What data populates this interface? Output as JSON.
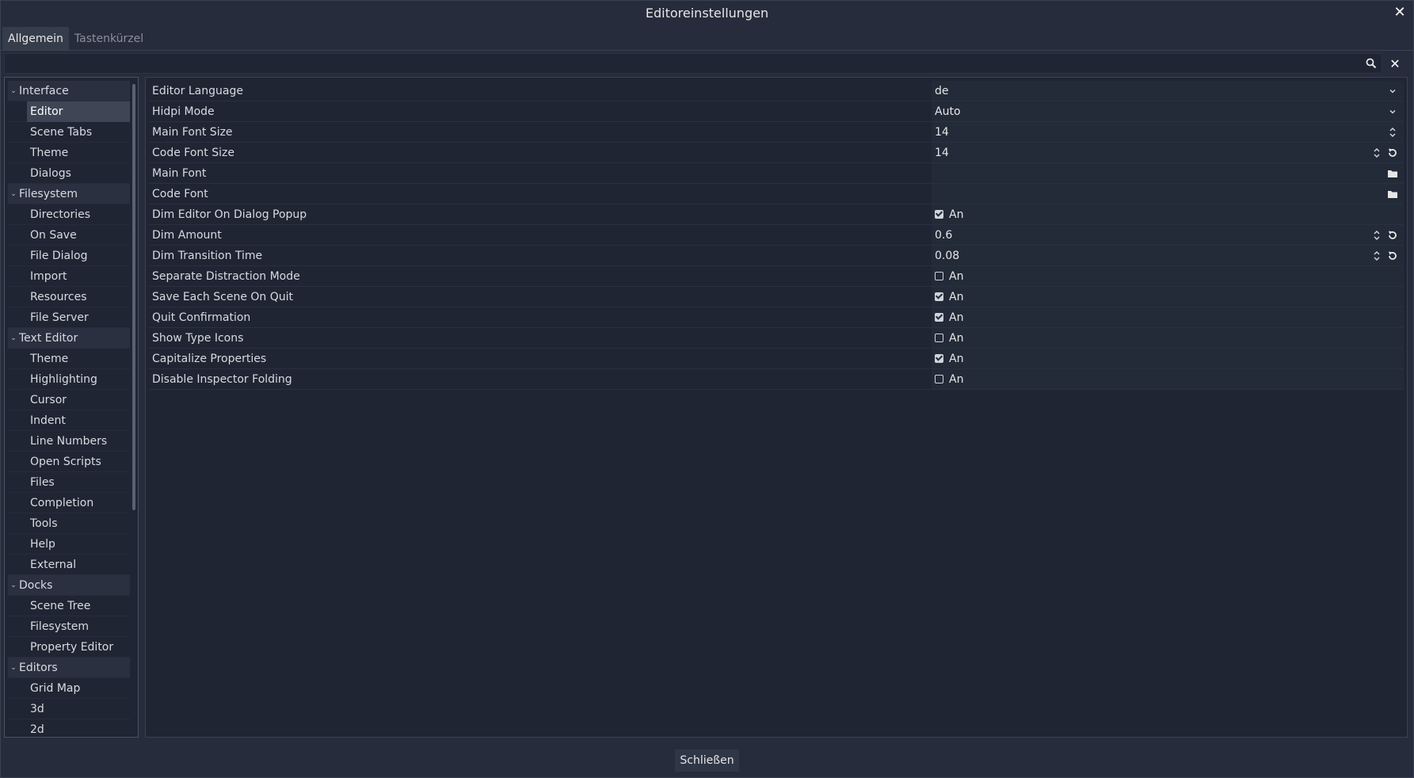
{
  "window": {
    "title": "Editoreinstellungen"
  },
  "tabs": [
    {
      "label": "Allgemein",
      "active": true
    },
    {
      "label": "Tastenkürzel",
      "active": false
    }
  ],
  "search": {
    "value": "",
    "placeholder": ""
  },
  "sidebar": {
    "items": [
      {
        "label": "Interface",
        "group": true
      },
      {
        "label": "Editor",
        "group": false,
        "selected": true
      },
      {
        "label": "Scene Tabs",
        "group": false
      },
      {
        "label": "Theme",
        "group": false
      },
      {
        "label": "Dialogs",
        "group": false
      },
      {
        "label": "Filesystem",
        "group": true
      },
      {
        "label": "Directories",
        "group": false
      },
      {
        "label": "On Save",
        "group": false
      },
      {
        "label": "File Dialog",
        "group": false
      },
      {
        "label": "Import",
        "group": false
      },
      {
        "label": "Resources",
        "group": false
      },
      {
        "label": "File Server",
        "group": false
      },
      {
        "label": "Text Editor",
        "group": true
      },
      {
        "label": "Theme",
        "group": false
      },
      {
        "label": "Highlighting",
        "group": false
      },
      {
        "label": "Cursor",
        "group": false
      },
      {
        "label": "Indent",
        "group": false
      },
      {
        "label": "Line Numbers",
        "group": false
      },
      {
        "label": "Open Scripts",
        "group": false
      },
      {
        "label": "Files",
        "group": false
      },
      {
        "label": "Completion",
        "group": false
      },
      {
        "label": "Tools",
        "group": false
      },
      {
        "label": "Help",
        "group": false
      },
      {
        "label": "External",
        "group": false
      },
      {
        "label": "Docks",
        "group": true
      },
      {
        "label": "Scene Tree",
        "group": false
      },
      {
        "label": "Filesystem",
        "group": false
      },
      {
        "label": "Property Editor",
        "group": false
      },
      {
        "label": "Editors",
        "group": true
      },
      {
        "label": "Grid Map",
        "group": false
      },
      {
        "label": "3d",
        "group": false
      },
      {
        "label": "2d",
        "group": false
      }
    ]
  },
  "properties": [
    {
      "name": "Editor Language",
      "kind": "dropdown",
      "value": "de"
    },
    {
      "name": "Hidpi Mode",
      "kind": "dropdown",
      "value": "Auto"
    },
    {
      "name": "Main Font Size",
      "kind": "spin",
      "value": "14",
      "revert": false
    },
    {
      "name": "Code Font Size",
      "kind": "spin",
      "value": "14",
      "revert": true
    },
    {
      "name": "Main Font",
      "kind": "file",
      "value": ""
    },
    {
      "name": "Code Font",
      "kind": "file",
      "value": ""
    },
    {
      "name": "Dim Editor On Dialog Popup",
      "kind": "check",
      "checked": true,
      "value": "An"
    },
    {
      "name": "Dim Amount",
      "kind": "spin",
      "value": "0.6",
      "revert": true
    },
    {
      "name": "Dim Transition Time",
      "kind": "spin",
      "value": "0.08",
      "revert": true
    },
    {
      "name": "Separate Distraction Mode",
      "kind": "check",
      "checked": false,
      "value": "An"
    },
    {
      "name": "Save Each Scene On Quit",
      "kind": "check",
      "checked": true,
      "value": "An"
    },
    {
      "name": "Quit Confirmation",
      "kind": "check",
      "checked": true,
      "value": "An"
    },
    {
      "name": "Show Type Icons",
      "kind": "check",
      "checked": false,
      "value": "An"
    },
    {
      "name": "Capitalize Properties",
      "kind": "check",
      "checked": true,
      "value": "An"
    },
    {
      "name": "Disable Inspector Folding",
      "kind": "check",
      "checked": false,
      "value": "An"
    }
  ],
  "footer": {
    "close_label": "Schließen"
  },
  "icons": {
    "window_close": "close-icon",
    "search": "search-icon",
    "clear": "clear-icon",
    "dropdown": "chevron-down-icon",
    "spin": "spinner-arrows-icon",
    "revert": "revert-icon",
    "folder": "folder-icon",
    "tree_expand": "chevron-down-icon"
  },
  "colors": {
    "background": "#262c3b",
    "panel": "#1f2533",
    "selected_row": "#3e4656",
    "text": "#e0e0e0",
    "muted_text": "#8b8f99"
  }
}
